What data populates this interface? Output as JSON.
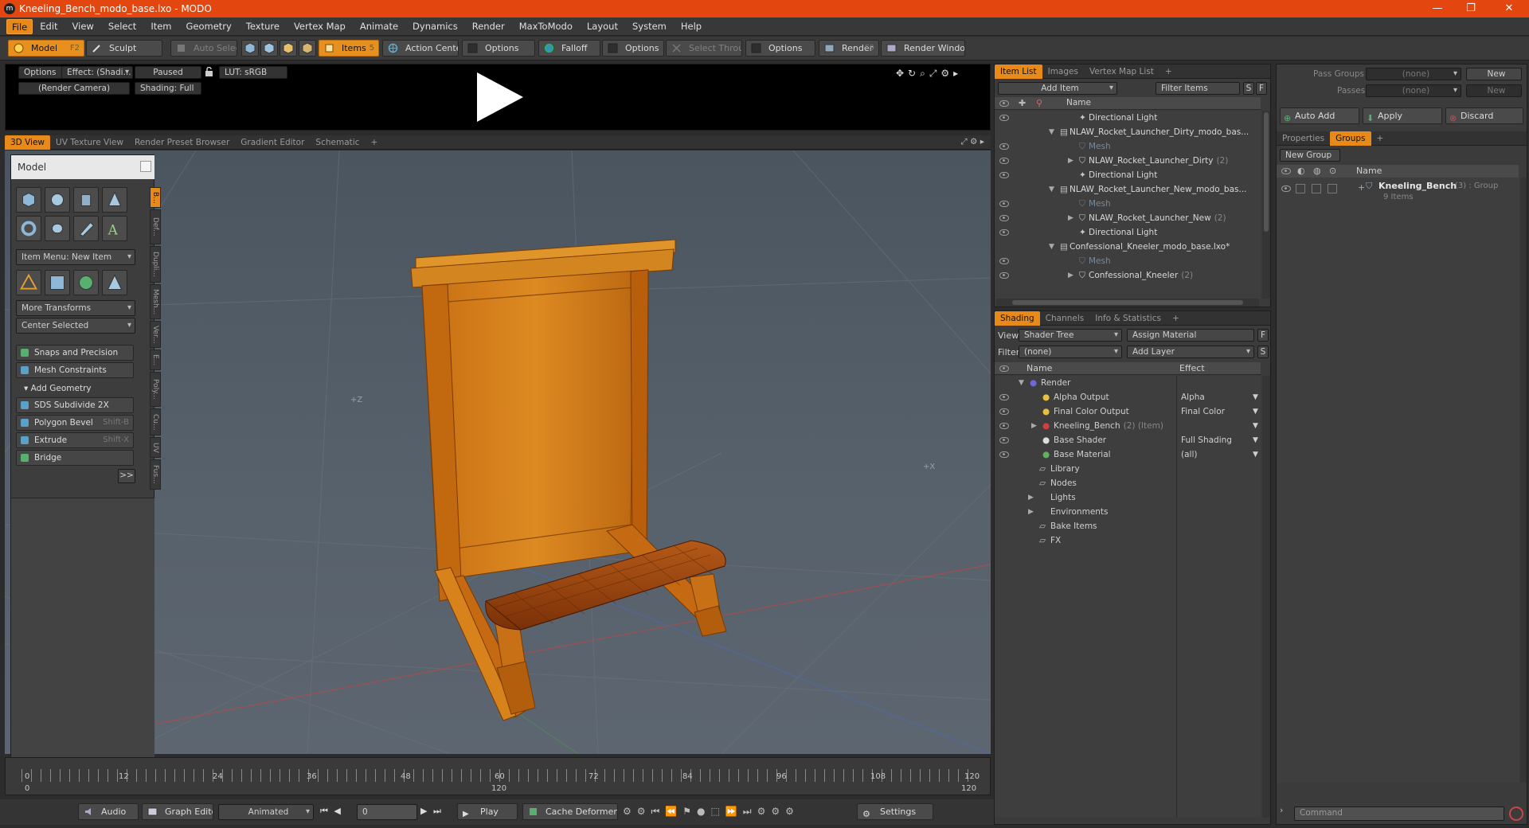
{
  "window": {
    "title": "Kneeling_Bench_modo_base.lxo - MODO",
    "logo": "modo-logo-icon",
    "min": "—",
    "max": "❐",
    "close": "✕"
  },
  "menu": [
    "File",
    "Edit",
    "View",
    "Select",
    "Item",
    "Geometry",
    "Texture",
    "Vertex Map",
    "Animate",
    "Dynamics",
    "Render",
    "MaxToModo",
    "Layout",
    "System",
    "Help"
  ],
  "toolbar": {
    "model": "Model",
    "model_key": "F2",
    "sculpt": "Sculpt",
    "auto_select": "Auto Select",
    "items": "Items",
    "items_key": "5",
    "action_center": "Action Center",
    "options1": "Options",
    "falloff": "Falloff",
    "options2": "Options",
    "select_through": "Select Through",
    "options3": "Options",
    "render": "Render",
    "render_key": "F9",
    "render_window": "Render Window"
  },
  "preview": {
    "options": "Options",
    "effect": "Effect: (Shadi...",
    "paused": "Paused",
    "lut": "LUT: sRGB",
    "camera": "(Render Camera)",
    "shading": "Shading: Full"
  },
  "viewport_tabs": [
    "3D View",
    "UV Texture View",
    "Render Preset Browser",
    "Gradient Editor",
    "Schematic",
    "+"
  ],
  "viewport": {
    "axis_z": "+Z",
    "axis_x": "+X",
    "accent": "#e78a1a"
  },
  "left_panel": {
    "title": "Model",
    "item_menu": "Item Menu: New Item",
    "more_transforms": "More Transforms",
    "center_selected": "Center Selected",
    "snaps": "Snaps and Precision",
    "mesh_constraints": "Mesh Constraints",
    "add_geometry": "Add Geometry",
    "sds": "SDS Subdivide 2X",
    "bevel": "Polygon Bevel",
    "bevel_key": "Shift-B",
    "extrude": "Extrude",
    "extrude_key": "Shift-X",
    "bridge": "Bridge",
    "more": ">>",
    "vtabs": [
      "B...",
      "Def...",
      "Dupli...",
      "Mesh...",
      "Ver...",
      "E...",
      "Poly...",
      "Cu...",
      "UV",
      "Fus..."
    ]
  },
  "timeline": {
    "ticks": [
      "0",
      "12",
      "24",
      "36",
      "48",
      "60",
      "72",
      "84",
      "96",
      "108",
      "120"
    ],
    "lower_ticks": [
      "0",
      "120",
      "120"
    ]
  },
  "bottombar": {
    "audio": "Audio",
    "graph_editor": "Graph Editor",
    "animated": "Animated",
    "frame": "0",
    "play": "Play",
    "cache": "Cache Deformers",
    "settings": "Settings"
  },
  "item_list": {
    "tabs": [
      "Item List",
      "Images",
      "Vertex Map List",
      "+"
    ],
    "add_item": "Add Item",
    "filter": "Filter Items",
    "s": "S",
    "f": "F",
    "header": "Name",
    "rows": [
      {
        "label": "Directional Light",
        "count": "",
        "indent": 3,
        "dim": false,
        "eye": true
      },
      {
        "label": "NLAW_Rocket_Launcher_Dirty_modo_bas...",
        "count": "",
        "indent": 1,
        "dim": false,
        "eye": false
      },
      {
        "label": "Mesh",
        "count": "",
        "indent": 3,
        "dim": true,
        "eye": true
      },
      {
        "label": "NLAW_Rocket_Launcher_Dirty",
        "count": "(2)",
        "indent": 3,
        "dim": false,
        "eye": true
      },
      {
        "label": "Directional Light",
        "count": "",
        "indent": 3,
        "dim": false,
        "eye": true
      },
      {
        "label": "NLAW_Rocket_Launcher_New_modo_bas...",
        "count": "",
        "indent": 1,
        "dim": false,
        "eye": false
      },
      {
        "label": "Mesh",
        "count": "",
        "indent": 3,
        "dim": true,
        "eye": true
      },
      {
        "label": "NLAW_Rocket_Launcher_New",
        "count": "(2)",
        "indent": 3,
        "dim": false,
        "eye": true
      },
      {
        "label": "Directional Light",
        "count": "",
        "indent": 3,
        "dim": false,
        "eye": true
      },
      {
        "label": "Confessional_Kneeler_modo_base.lxo*",
        "count": "",
        "indent": 1,
        "dim": false,
        "eye": false
      },
      {
        "label": "Mesh",
        "count": "",
        "indent": 3,
        "dim": true,
        "eye": true
      },
      {
        "label": "Confessional_Kneeler",
        "count": "(2)",
        "indent": 3,
        "dim": false,
        "eye": true
      }
    ]
  },
  "shading": {
    "tabs": [
      "Shading",
      "Channels",
      "Info & Statistics",
      "+"
    ],
    "view_label": "View",
    "view": "Shader Tree",
    "assign": "Assign Material",
    "f": "F",
    "filter_label": "Filter",
    "filter": "(none)",
    "add_layer": "Add Layer",
    "s": "S",
    "h_name": "Name",
    "h_effect": "Effect",
    "rows": [
      {
        "label": "Render",
        "effect": "",
        "indent": 1
      },
      {
        "label": "Alpha Output",
        "effect": "Alpha",
        "indent": 2
      },
      {
        "label": "Final Color Output",
        "effect": "Final Color",
        "indent": 2
      },
      {
        "label": "Kneeling_Bench",
        "extra": "(2) (Item)",
        "effect": "",
        "indent": 2
      },
      {
        "label": "Base Shader",
        "effect": "Full Shading",
        "indent": 2
      },
      {
        "label": "Base Material",
        "effect": "(all)",
        "indent": 2
      },
      {
        "label": "Library",
        "effect": "",
        "indent": 0
      },
      {
        "label": "Nodes",
        "effect": "",
        "indent": 0
      },
      {
        "label": "Lights",
        "effect": "",
        "indent": 0
      },
      {
        "label": "Environments",
        "effect": "",
        "indent": 0
      },
      {
        "label": "Bake Items",
        "effect": "",
        "indent": 0
      },
      {
        "label": "FX",
        "effect": "",
        "indent": 0
      }
    ]
  },
  "groups": {
    "pass_groups": "Pass Groups",
    "pass_none": "(none)",
    "new": "New",
    "passes": "Passes",
    "passes_none": "(none)",
    "new2": "New",
    "auto_add": "Auto Add",
    "apply": "Apply",
    "discard": "Discard",
    "tabs": [
      "Properties",
      "Groups",
      "+"
    ],
    "new_group": "New Group",
    "header": "Name",
    "group_name": "Kneeling_Bench",
    "group_meta": "(3) : Group",
    "group_items": "9 Items",
    "command": "Command"
  }
}
